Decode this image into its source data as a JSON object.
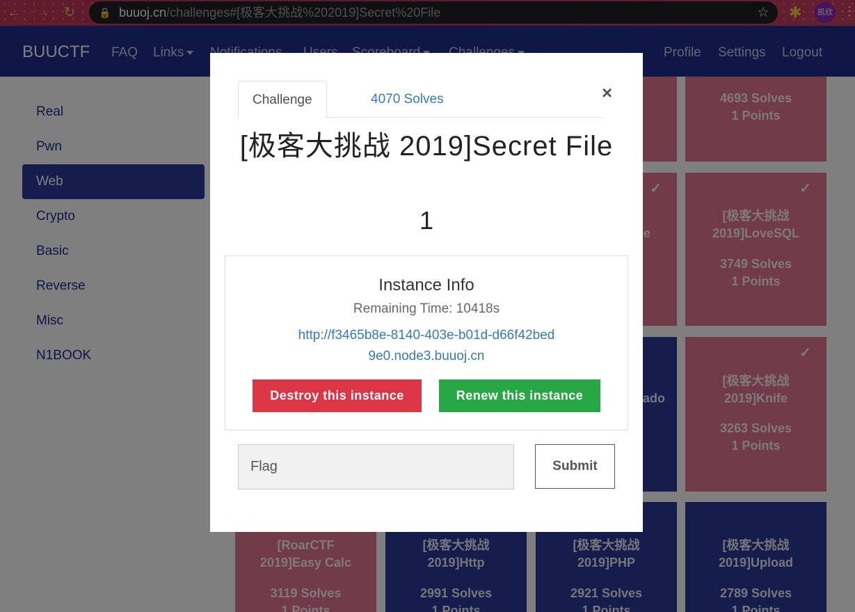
{
  "browser": {
    "url_host": "buuoj.cn",
    "url_path": "/challenges#[极客大挑战%202019]Secret%20File",
    "avatar_text": "凯欣"
  },
  "navbar": {
    "brand": "BUUCTF",
    "links": [
      "FAQ",
      "Links",
      "Notifications",
      "Users",
      "Scoreboard",
      "Challenges"
    ],
    "right_links": [
      "Profile",
      "Settings",
      "Logout"
    ]
  },
  "sidebar": {
    "items": [
      "Real",
      "Pwn",
      "Web",
      "Crypto",
      "Basic",
      "Reverse",
      "Misc",
      "N1BOOK"
    ],
    "active": "Web"
  },
  "cards": [
    {
      "name": "",
      "solves": "4693 Solves",
      "points": "1 Points",
      "solved": true
    },
    {
      "name": "[极客大挑战 2019]LoveSQL",
      "solves": "3749 Solves",
      "points": "1 Points",
      "solved": true
    },
    {
      "name": "[极客大挑战 2019]Knife",
      "solves": "3263 Solves",
      "points": "1 Points",
      "solved": true
    },
    {
      "name": "[RoarCTF 2019]Easy Calc",
      "solves": "3119 Solves",
      "points": "1 Points",
      "solved": true
    },
    {
      "name": "[极客大挑战 2019]Http",
      "solves": "2991 Solves",
      "points": "1 Points",
      "solved": false
    },
    {
      "name": "[极客大挑战 2019]PHP",
      "solves": "2921 Solves",
      "points": "1 Points",
      "solved": false
    },
    {
      "name": "[极客大挑战 2019]Upload",
      "solves": "2789 Solves",
      "points": "1 Points",
      "solved": false
    },
    {
      "name": "le",
      "solved": true
    },
    {
      "name": "nado",
      "solved": false
    }
  ],
  "modal": {
    "tabs": {
      "challenge": "Challenge",
      "solves": "4070 Solves"
    },
    "close": "×",
    "title": "[极客大挑战 2019]Secret File",
    "value": "1",
    "instance": {
      "heading": "Instance Info",
      "remaining": "Remaining Time: 10418s",
      "url": "http://f3465b8e-8140-403e-b01d-d66f42bed9e0.node3.buuoj.cn",
      "destroy_label": "Destroy this instance",
      "renew_label": "Renew this instance"
    },
    "flag_placeholder": "Flag",
    "submit_label": "Submit"
  },
  "colors": {
    "navbar": "#1f2f8e",
    "solved_card": "#e47795",
    "unsolved_card": "#2b3a9a",
    "destroy": "#dc3545",
    "renew": "#28a745",
    "link": "#337ab7"
  }
}
